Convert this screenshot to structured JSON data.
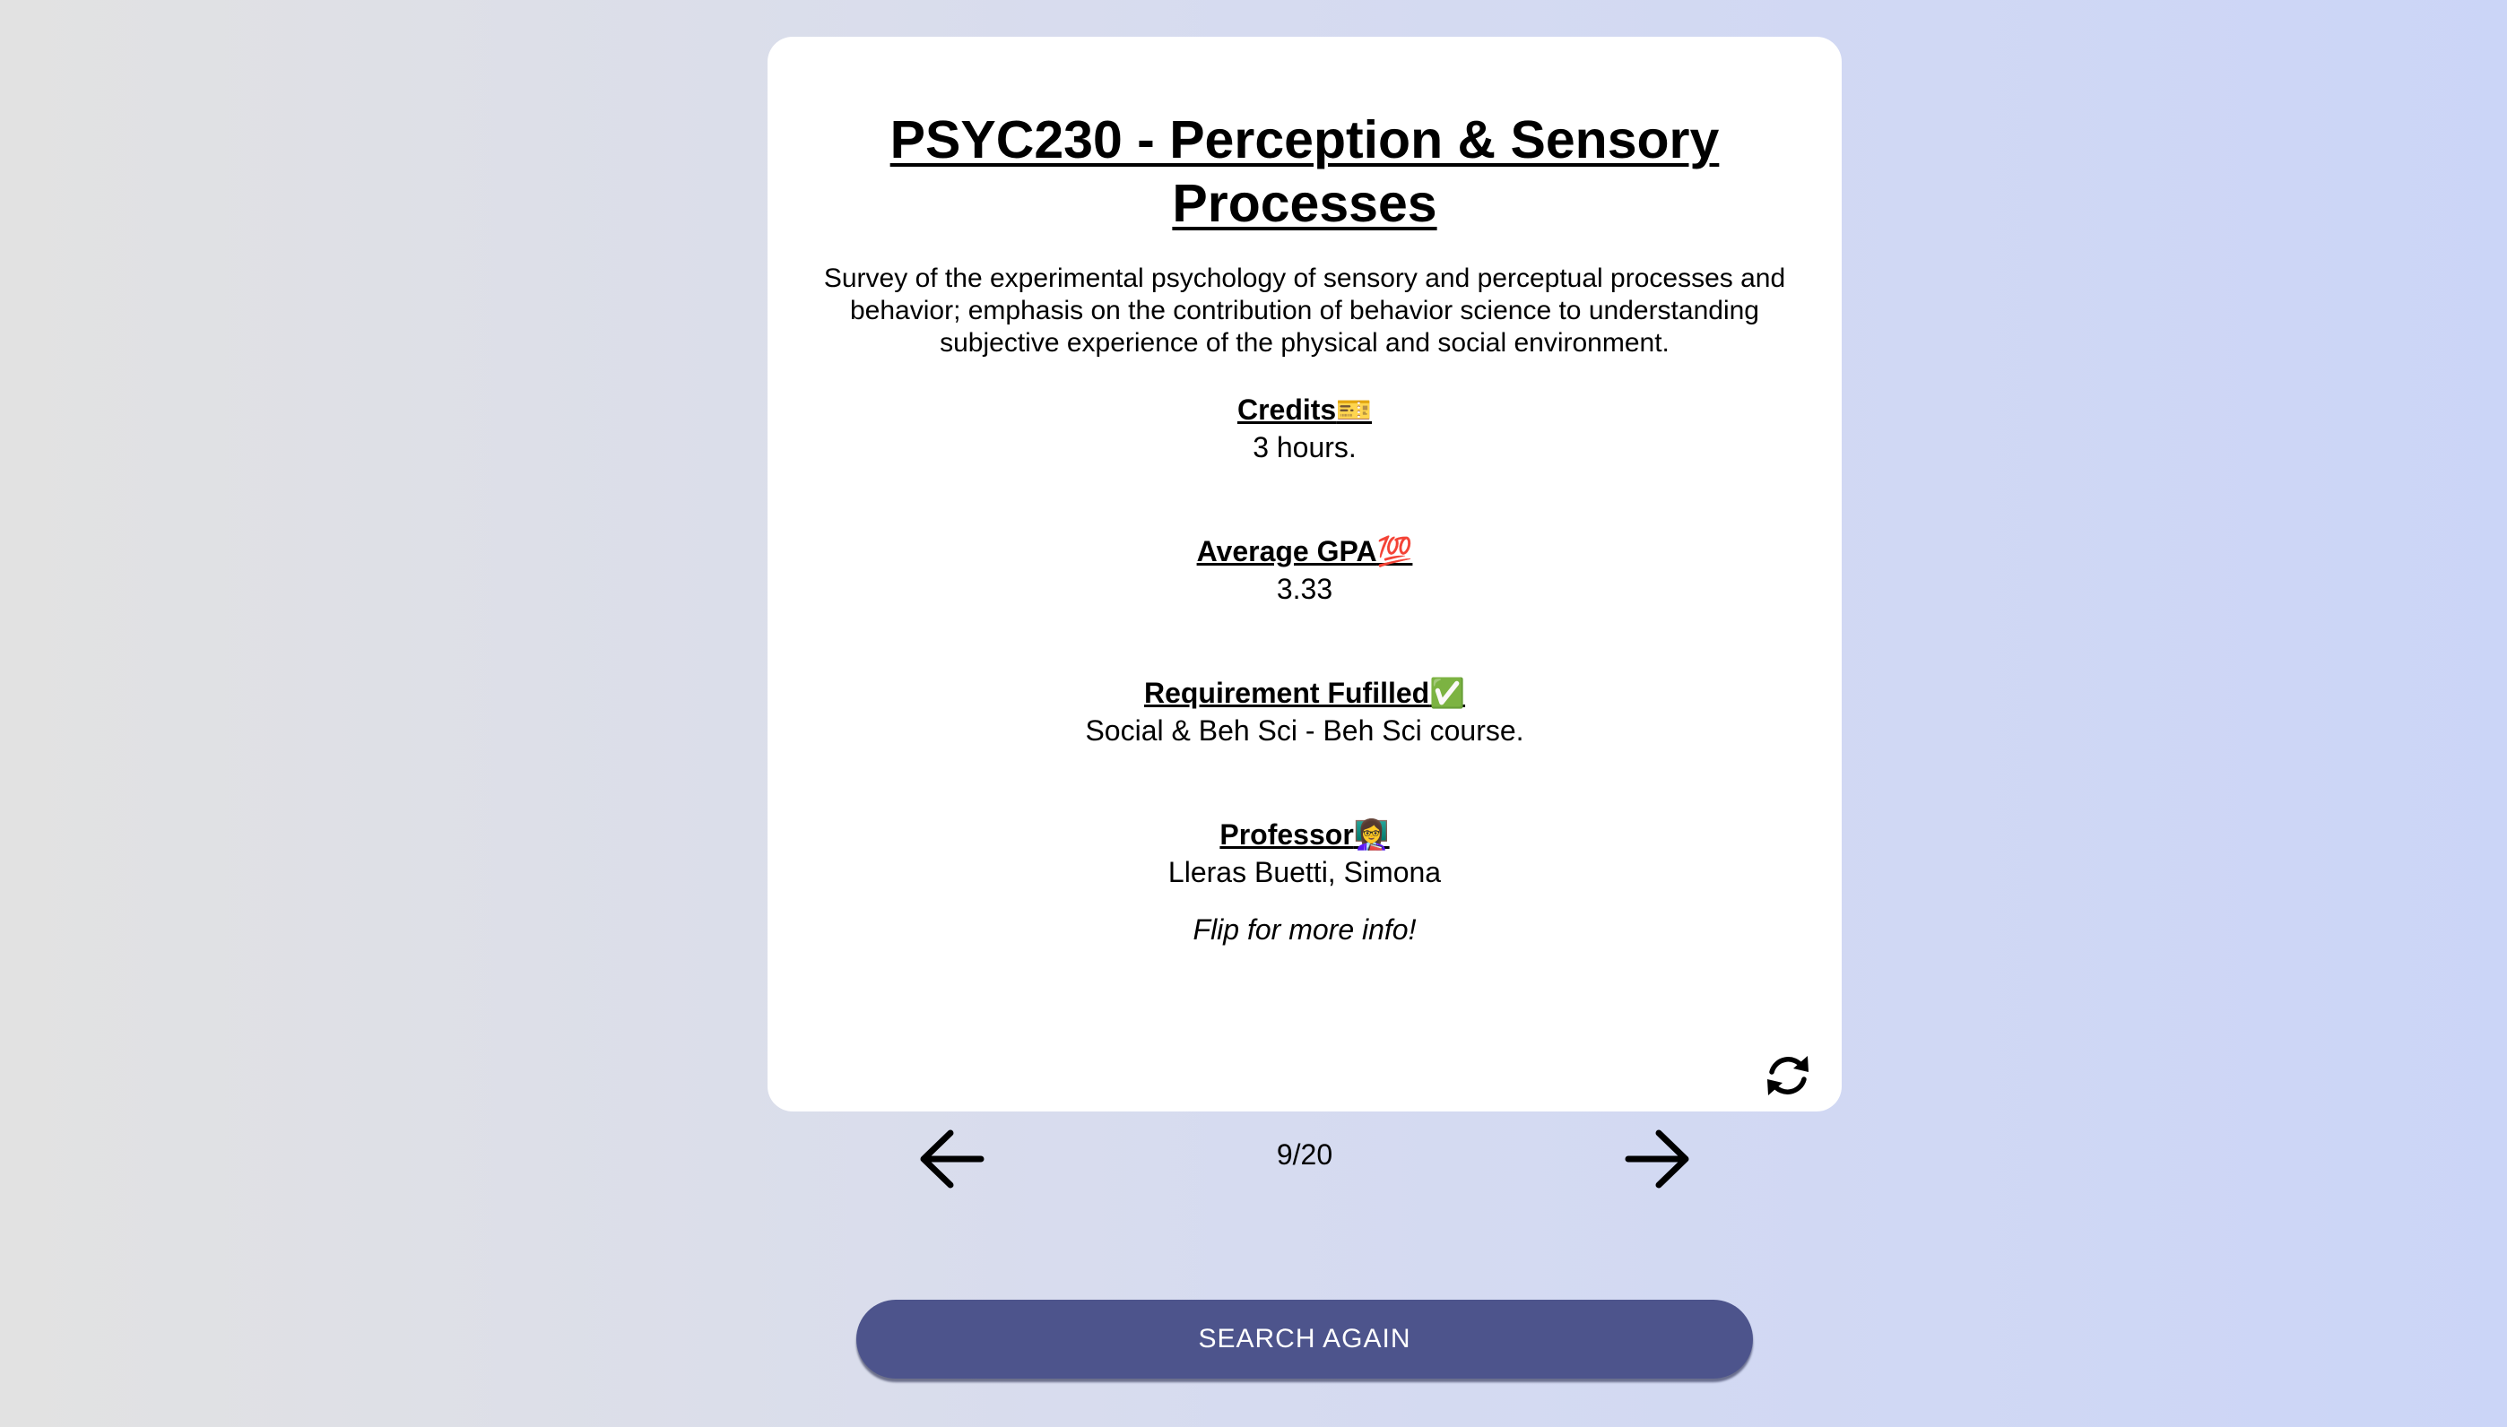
{
  "course": {
    "title": "PSYC230 - Perception & Sensory Processes",
    "description": "Survey of the experimental psychology of sensory and perceptual processes and behavior; emphasis on the contribution of behavior science to understanding subjective experience of the physical and social environment."
  },
  "fields": {
    "credits": {
      "label": "Credits",
      "emoji": "🎫",
      "value": "3 hours."
    },
    "gpa": {
      "label": "Average GPA",
      "emoji": "💯",
      "value": "3.33"
    },
    "requirement": {
      "label": "Requirement Fufilled",
      "emoji": "✅",
      "value": "Social & Beh Sci - Beh Sci course."
    },
    "professor": {
      "label": "Professor",
      "emoji": "👩‍🏫",
      "value": "Lleras Buetti, Simona"
    }
  },
  "flip_note": "Flip for more info!",
  "pagination": {
    "counter": "9/20"
  },
  "search_button": {
    "label": "SEARCH AGAIN"
  },
  "icons": {
    "flip": "refresh-icon",
    "prev": "arrow-left-icon",
    "next": "arrow-right-icon"
  },
  "colors": {
    "button": "#4d548c",
    "card": "#ffffff"
  }
}
